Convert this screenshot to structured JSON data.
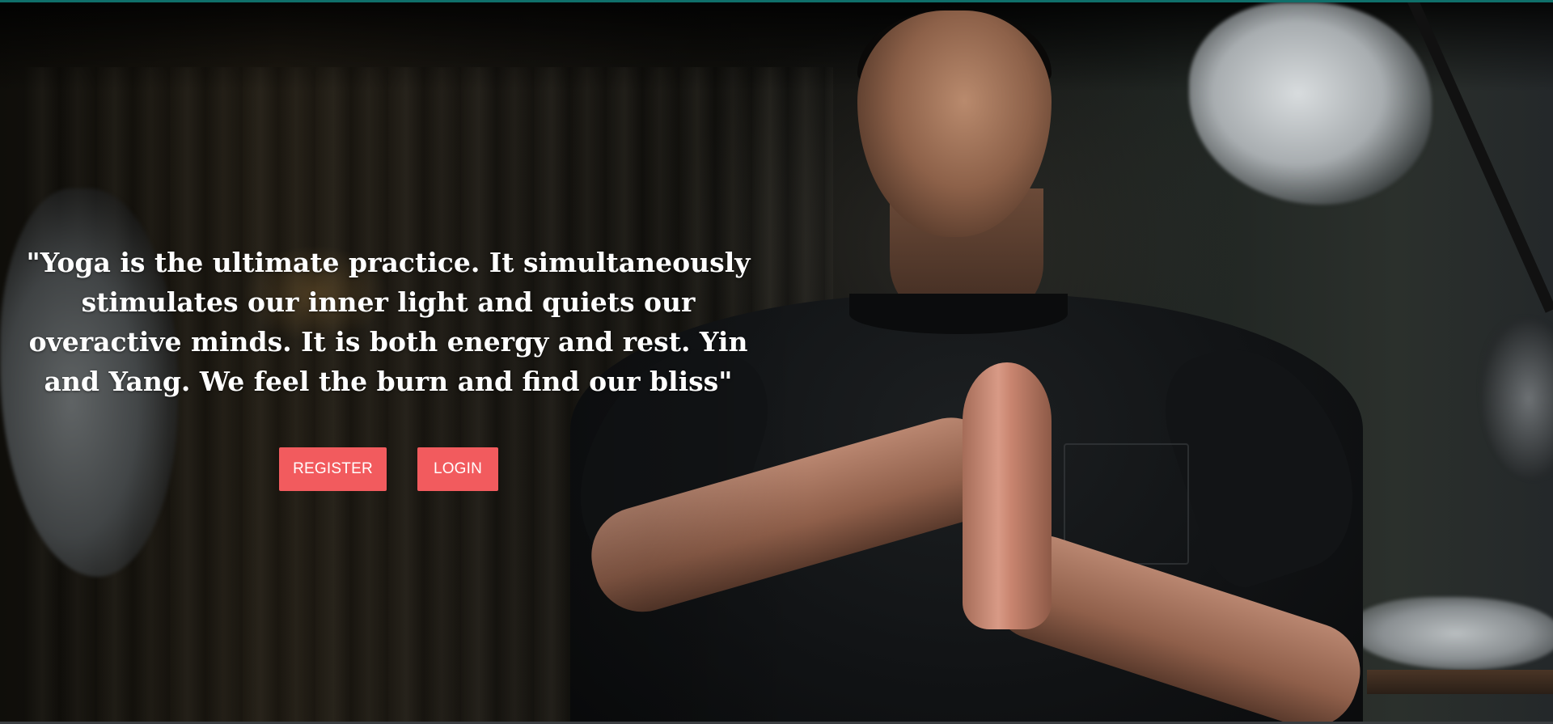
{
  "hero": {
    "quote": "\"Yoga is the ultimate practice. It simultaneously stimulates our inner light and quiets our overactive minds. It is both energy and rest. Yin and Yang. We feel the burn and find our bliss\"",
    "background": "person-meditating-photo"
  },
  "actions": {
    "register_label": "REGISTER",
    "login_label": "LOGIN"
  },
  "colors": {
    "button": "#f25b5e",
    "button_text": "#ffffff",
    "quote_text": "#ffffff",
    "top_strip": "#0f6f6a"
  }
}
